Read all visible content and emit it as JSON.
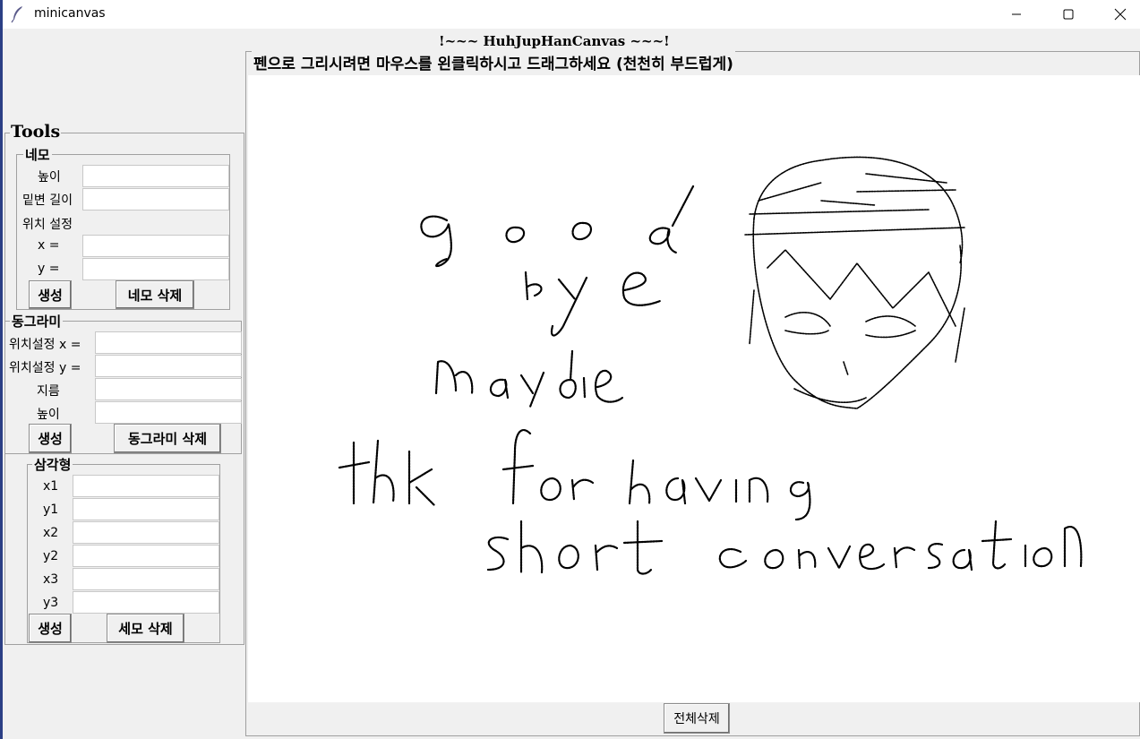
{
  "window": {
    "title": "minicanvas",
    "icons": [
      "feather-icon",
      "minimize-icon",
      "maximize-icon",
      "close-icon"
    ]
  },
  "heading": "!~~~ HuhJupHanCanvas ~~~!",
  "canvas": {
    "instruction": "펜으로 그리시려면 마우스를 왼클릭하시고 드래그하세요 (천천히 부드럽게)",
    "drawing_text": [
      "good",
      "bye",
      "maydie",
      "thk for having",
      "short conversation"
    ],
    "clear_all_label": "전체삭제"
  },
  "tools": {
    "title": "Tools",
    "rectangle": {
      "title": "네모",
      "height_label": "높이",
      "base_label": "밑변 길이",
      "position_label": "위치 설정",
      "x_label": "x =",
      "y_label": "y =",
      "create_label": "생성",
      "delete_label": "네모 삭제"
    },
    "circle": {
      "title": "동그라미",
      "x_label": "위치설정 x =",
      "y_label": "위치설정 y =",
      "diameter_label": "지름",
      "height_label": "높이",
      "create_label": "생성",
      "delete_label": "동그라미 삭제"
    },
    "triangle": {
      "title": "삼각형",
      "x1_label": "x1",
      "y1_label": "y1",
      "x2_label": "x2",
      "y2_label": "y2",
      "x3_label": "x3",
      "y3_label": "y3",
      "create_label": "생성",
      "delete_label": "세모 삭제"
    }
  }
}
